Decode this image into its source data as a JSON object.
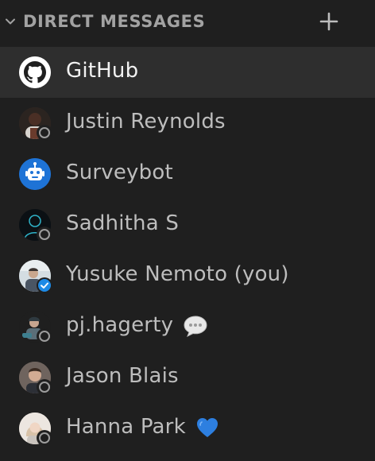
{
  "header": {
    "title": "DIRECT MESSAGES",
    "collapse_icon": "chevron-down-icon",
    "add_icon": "plus-icon"
  },
  "colors": {
    "background": "#1f1f1f",
    "active_row": "#2e2e2e",
    "name_text": "#bdbdbd",
    "active_text": "#f2f2f2",
    "header_text": "#a2a2a2",
    "verified_blue": "#1d8ae6",
    "surveybot_blue": "#1e73d6",
    "heart_blue": "#2d7fe0"
  },
  "dm_list": [
    {
      "name": "GitHub",
      "status": "none",
      "active": true,
      "avatar": "github-logo-icon"
    },
    {
      "name": "Justin Reynolds",
      "status": "offline",
      "active": false,
      "avatar": "user-photo"
    },
    {
      "name": "Surveybot",
      "status": "none",
      "active": false,
      "avatar": "robot-icon"
    },
    {
      "name": "Sadhitha S",
      "status": "offline",
      "active": false,
      "avatar": "user-photo"
    },
    {
      "name": "Yusuke Nemoto (you)",
      "status": "verified",
      "active": false,
      "avatar": "user-photo"
    },
    {
      "name": "pj.hagerty",
      "status": "offline",
      "active": false,
      "avatar": "user-photo",
      "emoji": "speech-bubble-icon"
    },
    {
      "name": "Jason Blais",
      "status": "offline",
      "active": false,
      "avatar": "user-photo"
    },
    {
      "name": "Hanna Park",
      "status": "offline",
      "active": false,
      "avatar": "user-photo",
      "emoji": "blue-heart-icon"
    }
  ]
}
